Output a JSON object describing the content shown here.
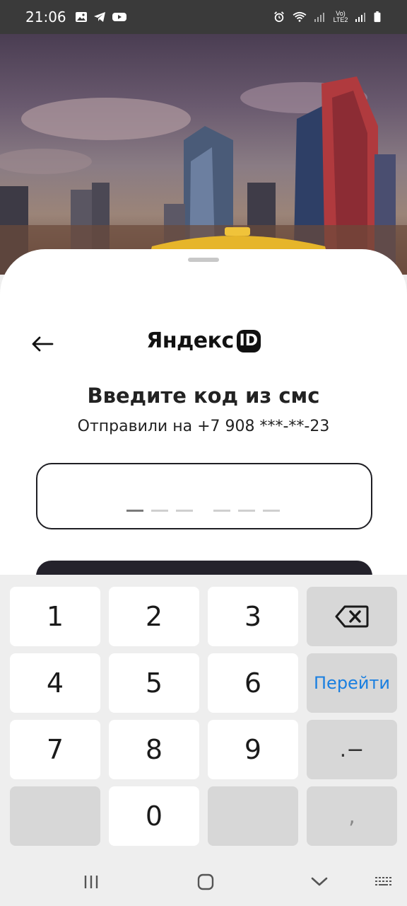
{
  "status_bar": {
    "time": "21:06",
    "lte_label": "Vo) LTE2",
    "left_icons": [
      "gallery-icon",
      "telegram-icon",
      "youtube-icon"
    ],
    "right_icons": [
      "alarm-icon",
      "wifi-icon",
      "signal-icon",
      "battery-icon"
    ]
  },
  "header": {
    "logo_text": "Яндекс",
    "logo_badge": "ID",
    "back_icon": "arrow-left-icon"
  },
  "form": {
    "title": "Введите код из смс",
    "subtitle": "Отправили на +7 908 ***-**-23",
    "code_length": 6
  },
  "keyboard": {
    "keys": {
      "k1": "1",
      "k2": "2",
      "k3": "3",
      "k4": "4",
      "k5": "5",
      "k6": "6",
      "k7": "7",
      "k8": "8",
      "k9": "9",
      "k0": "0",
      "go": "Перейти",
      "dot_dash": ".−",
      "comma": ","
    },
    "backspace_icon": "backspace-icon",
    "accent_color": "#1a7fe0"
  },
  "nav_bar": {
    "icons": [
      "recent-apps-icon",
      "home-icon",
      "back-chevron-icon",
      "keyboard-icon"
    ]
  },
  "colors": {
    "status_bar_bg": "#3a3a3a",
    "button_dark": "#24222b",
    "key_gray": "#d7d7d7"
  }
}
